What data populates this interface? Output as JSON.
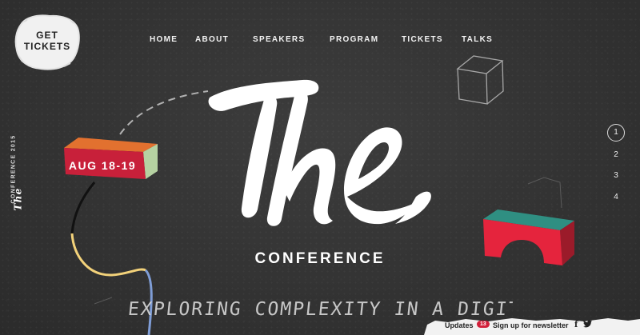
{
  "cta": {
    "label_line1": "GET",
    "label_line2": "TICKETS"
  },
  "nav": {
    "items": [
      {
        "label": "HOME"
      },
      {
        "label": "ABOUT"
      },
      {
        "label": "SPEAKERS"
      },
      {
        "label": "PROGRAM"
      },
      {
        "label": "TICKETS"
      },
      {
        "label": "TALKS"
      }
    ]
  },
  "sidebar": {
    "text": "CONFERENCE 2015",
    "logo": "The"
  },
  "hero": {
    "title": "The",
    "subtitle": "CONFERENCE",
    "date_badge": "AUG 18-19",
    "tagline": "EXPLORING COMPLEXITY IN A DIGITAL WORLD"
  },
  "pager": {
    "items": [
      "1",
      "2",
      "3",
      "4"
    ],
    "active": "1"
  },
  "footer": {
    "updates_label": "Updates",
    "updates_count": "13",
    "newsletter_label": "Sign up for newsletter",
    "facebook_icon": "f",
    "twitter_icon": "twitter-bird"
  },
  "colors": {
    "background": "#333333",
    "brick_red": "#c8203a",
    "brick_orange": "#e2712f",
    "brick_green": "#b6d2a2",
    "arch_red": "#e5243d",
    "arch_teal": "#2f8f82",
    "string_yellow": "#f3d27a",
    "string_blue": "#7f9dd6"
  }
}
